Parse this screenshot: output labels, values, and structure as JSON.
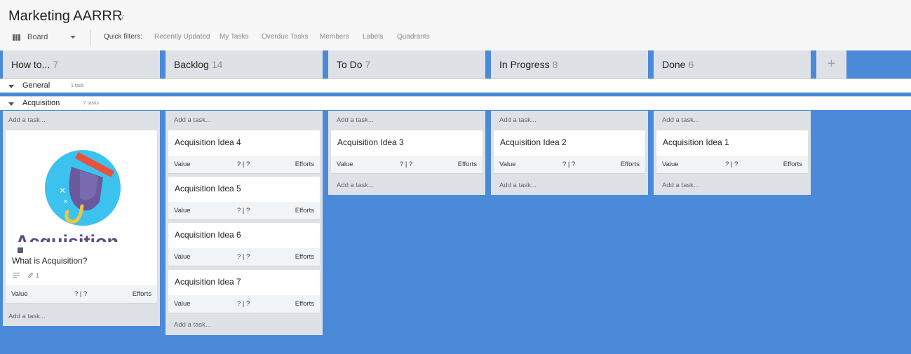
{
  "header": {
    "title": "Marketing AARRR",
    "star_icon": "star-icon",
    "view": "Board",
    "quick_filters_label": "Quick filters:",
    "quick_filters": [
      "Recently Updated",
      "My Tasks",
      "Overdue Tasks",
      "Members",
      "Labels",
      "Quadrants"
    ]
  },
  "columns": [
    {
      "name": "How to...",
      "count": "7"
    },
    {
      "name": "Backlog",
      "count": "14"
    },
    {
      "name": "To Do",
      "count": "7"
    },
    {
      "name": "In Progress",
      "count": "8"
    },
    {
      "name": "Done",
      "count": "6"
    }
  ],
  "add_column_label": "+",
  "swimlanes": [
    {
      "name": "General",
      "count": "1 task"
    },
    {
      "name": "Acquisition",
      "count": "7 tasks"
    }
  ],
  "add_task_label": "Add a task...",
  "card_footer": {
    "value_label": "Value",
    "score": "? | ?",
    "efforts_label": "Efforts"
  },
  "how_to_card": {
    "image_word": "Acquisition",
    "title": "What is Acquisition?",
    "attachments": "1"
  },
  "cards": {
    "backlog": [
      "Acquisition Idea 4",
      "Acquisition Idea 5",
      "Acquisition Idea 6",
      "Acquisition Idea 7"
    ],
    "todo": [
      "Acquisition Idea 3"
    ],
    "in_progress": [
      "Acquisition Idea 2"
    ],
    "done": [
      "Acquisition Idea 1"
    ]
  },
  "colors": {
    "board_background": "#4a8ad8",
    "column_background": "#dee2e6",
    "card_footer": "#f1f4f6"
  }
}
